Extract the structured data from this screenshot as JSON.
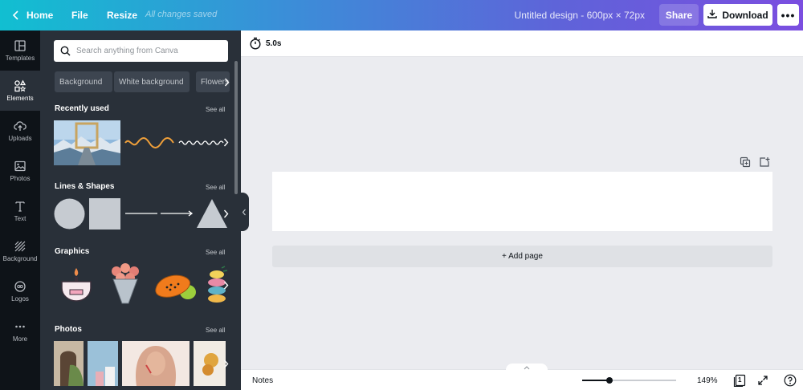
{
  "topbar": {
    "home": "Home",
    "file": "File",
    "resize": "Resize",
    "saved_status": "All changes saved",
    "design_title": "Untitled design - 600px × 72px",
    "share": "Share",
    "download": "Download",
    "more": "•••"
  },
  "rail": {
    "items": [
      {
        "label": "Templates",
        "icon": "templates-icon"
      },
      {
        "label": "Elements",
        "icon": "elements-icon",
        "active": true
      },
      {
        "label": "Uploads",
        "icon": "upload-cloud-icon"
      },
      {
        "label": "Photos",
        "icon": "image-icon"
      },
      {
        "label": "Text",
        "icon": "text-icon"
      },
      {
        "label": "Background",
        "icon": "hatch-icon"
      },
      {
        "label": "Logos",
        "icon": "logo-badge-icon"
      },
      {
        "label": "More",
        "icon": "ellipsis-icon"
      }
    ]
  },
  "panel": {
    "search_placeholder": "Search anything from Canva",
    "chips": [
      "Background",
      "White background",
      "Flowers"
    ],
    "sections": {
      "recent": {
        "title": "Recently used",
        "see_all": "See all"
      },
      "lines": {
        "title": "Lines & Shapes",
        "see_all": "See all"
      },
      "graphics": {
        "title": "Graphics",
        "see_all": "See all"
      },
      "photos": {
        "title": "Photos",
        "see_all": "See all"
      }
    }
  },
  "canvas": {
    "duration": "5.0s",
    "add_page": "+ Add page"
  },
  "footer": {
    "notes": "Notes",
    "zoom": "149%",
    "zoom_level": 0.29,
    "page_count": "1"
  },
  "colors": {
    "accent_gradient_start": "#11bfd1",
    "accent_gradient_end": "#7b4ee0",
    "panel_bg": "#293039",
    "rail_bg": "#0e1318"
  }
}
